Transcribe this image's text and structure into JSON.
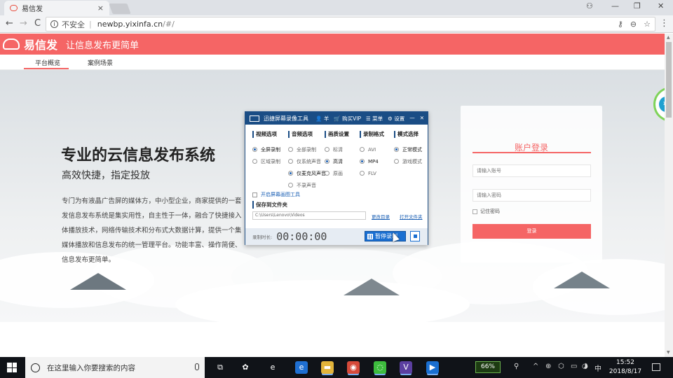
{
  "browser": {
    "tab_title": "易信发",
    "tab_close": "×",
    "security_label": "不安全",
    "url_host": "newbp.yixinfa.cn",
    "url_path": "/#/",
    "back": "←",
    "forward": "→",
    "reload": "C",
    "win_account": "⚇",
    "win_minimize": "—",
    "win_maximize": "❐",
    "win_close": "✕",
    "omni_key": "⚷",
    "omni_zoom": "⊖",
    "omni_star": "☆",
    "omni_menu": "⋮"
  },
  "site": {
    "logo_text": "易信发",
    "slogan": "让信息发布更简单",
    "nav": [
      {
        "label": "平台概览",
        "active": true
      },
      {
        "label": "案例场景",
        "active": false
      }
    ],
    "hero_title": "专业的云信息发布系统",
    "hero_subtitle": "高效快捷，指定投放",
    "hero_desc_lines": [
      "专门为有液晶广告屏的媒体方，中小型企业，商家提供的一套",
      "发信息发布系统是集实用性，自主性于一体，融合了快捷接入",
      "体播放技术，网络传输技术和分布式大数据计算，提供一个集",
      "媒体播放和信息发布的统一管理平台。功能丰富、操作简便、",
      "信息发布更简单。"
    ]
  },
  "login": {
    "title": "账户登录",
    "account_placeholder": "请输入账号",
    "password_placeholder": "请输入密码",
    "remember_label": "记住密码",
    "submit_label": "登录"
  },
  "recorder": {
    "title": "迅捷屏幕录像工具",
    "user": "👤 羊",
    "vip": "🛒 购买VIP",
    "menu": "☰ 菜单",
    "settings": "⚙ 设置",
    "minimize": "—",
    "close": "✕",
    "columns": [
      {
        "head": "视频选项",
        "options": [
          {
            "label": "全屏录制",
            "on": true
          },
          {
            "label": "区域录制",
            "on": false
          }
        ]
      },
      {
        "head": "音频选项",
        "options": [
          {
            "label": "全部录制",
            "on": false
          },
          {
            "label": "仅系统声音",
            "on": false
          },
          {
            "label": "仅麦克风声音",
            "on": true
          },
          {
            "label": "不录声音",
            "on": false
          }
        ]
      },
      {
        "head": "画质设置",
        "options": [
          {
            "label": "标清",
            "on": false
          },
          {
            "label": "高清",
            "on": true
          },
          {
            "label": "原画",
            "on": false
          }
        ]
      },
      {
        "head": "录制格式",
        "options": [
          {
            "label": "AVI",
            "on": false
          },
          {
            "label": "MP4",
            "on": true
          },
          {
            "label": "FLV",
            "on": false
          }
        ]
      },
      {
        "head": "模式选择",
        "options": [
          {
            "label": "正常模式",
            "on": true
          },
          {
            "label": "游戏模式",
            "on": false
          }
        ]
      }
    ],
    "pen_tool": "开启屏幕画图工具",
    "save_heading": "保存到文件夹",
    "save_path": "C:\\Users\\Lenovo\\Videos",
    "change_dir": "更改目录",
    "open_dir": "打开文件夹",
    "duration_label": "录制时长:",
    "duration": "00:00:00",
    "pause_label": "暂停录制"
  },
  "side_widget_text": "1M",
  "taskbar": {
    "search_placeholder": "在这里输入你要搜索的内容",
    "battery": "66%",
    "time": "15:52",
    "date": "2018/8/17",
    "ime": "中",
    "apps": [
      {
        "name": "task-view-icon",
        "glyph": "⧉",
        "color": "transparent"
      },
      {
        "name": "pinwheel-app-icon",
        "glyph": "✿",
        "color": "transparent"
      },
      {
        "name": "ie-icon",
        "glyph": "e",
        "color": "transparent"
      },
      {
        "name": "edge-icon",
        "glyph": "e",
        "color": "#1f6fd1"
      },
      {
        "name": "file-explorer-icon",
        "glyph": "▬",
        "color": "#e2b43a"
      },
      {
        "name": "chrome-icon",
        "glyph": "◉",
        "color": "#d64a3a"
      },
      {
        "name": "wechat-icon",
        "glyph": "◌",
        "color": "#3dbb3d"
      },
      {
        "name": "visual-studio-icon",
        "glyph": "V",
        "color": "#5b3fa0"
      },
      {
        "name": "screen-recorder-icon",
        "glyph": "▶",
        "color": "#1a6fd1"
      }
    ],
    "tray_icons": [
      "⚲",
      "^",
      "⊕",
      "⬡",
      "▭",
      "◑",
      "♪"
    ],
    "notifications": "🗨"
  }
}
